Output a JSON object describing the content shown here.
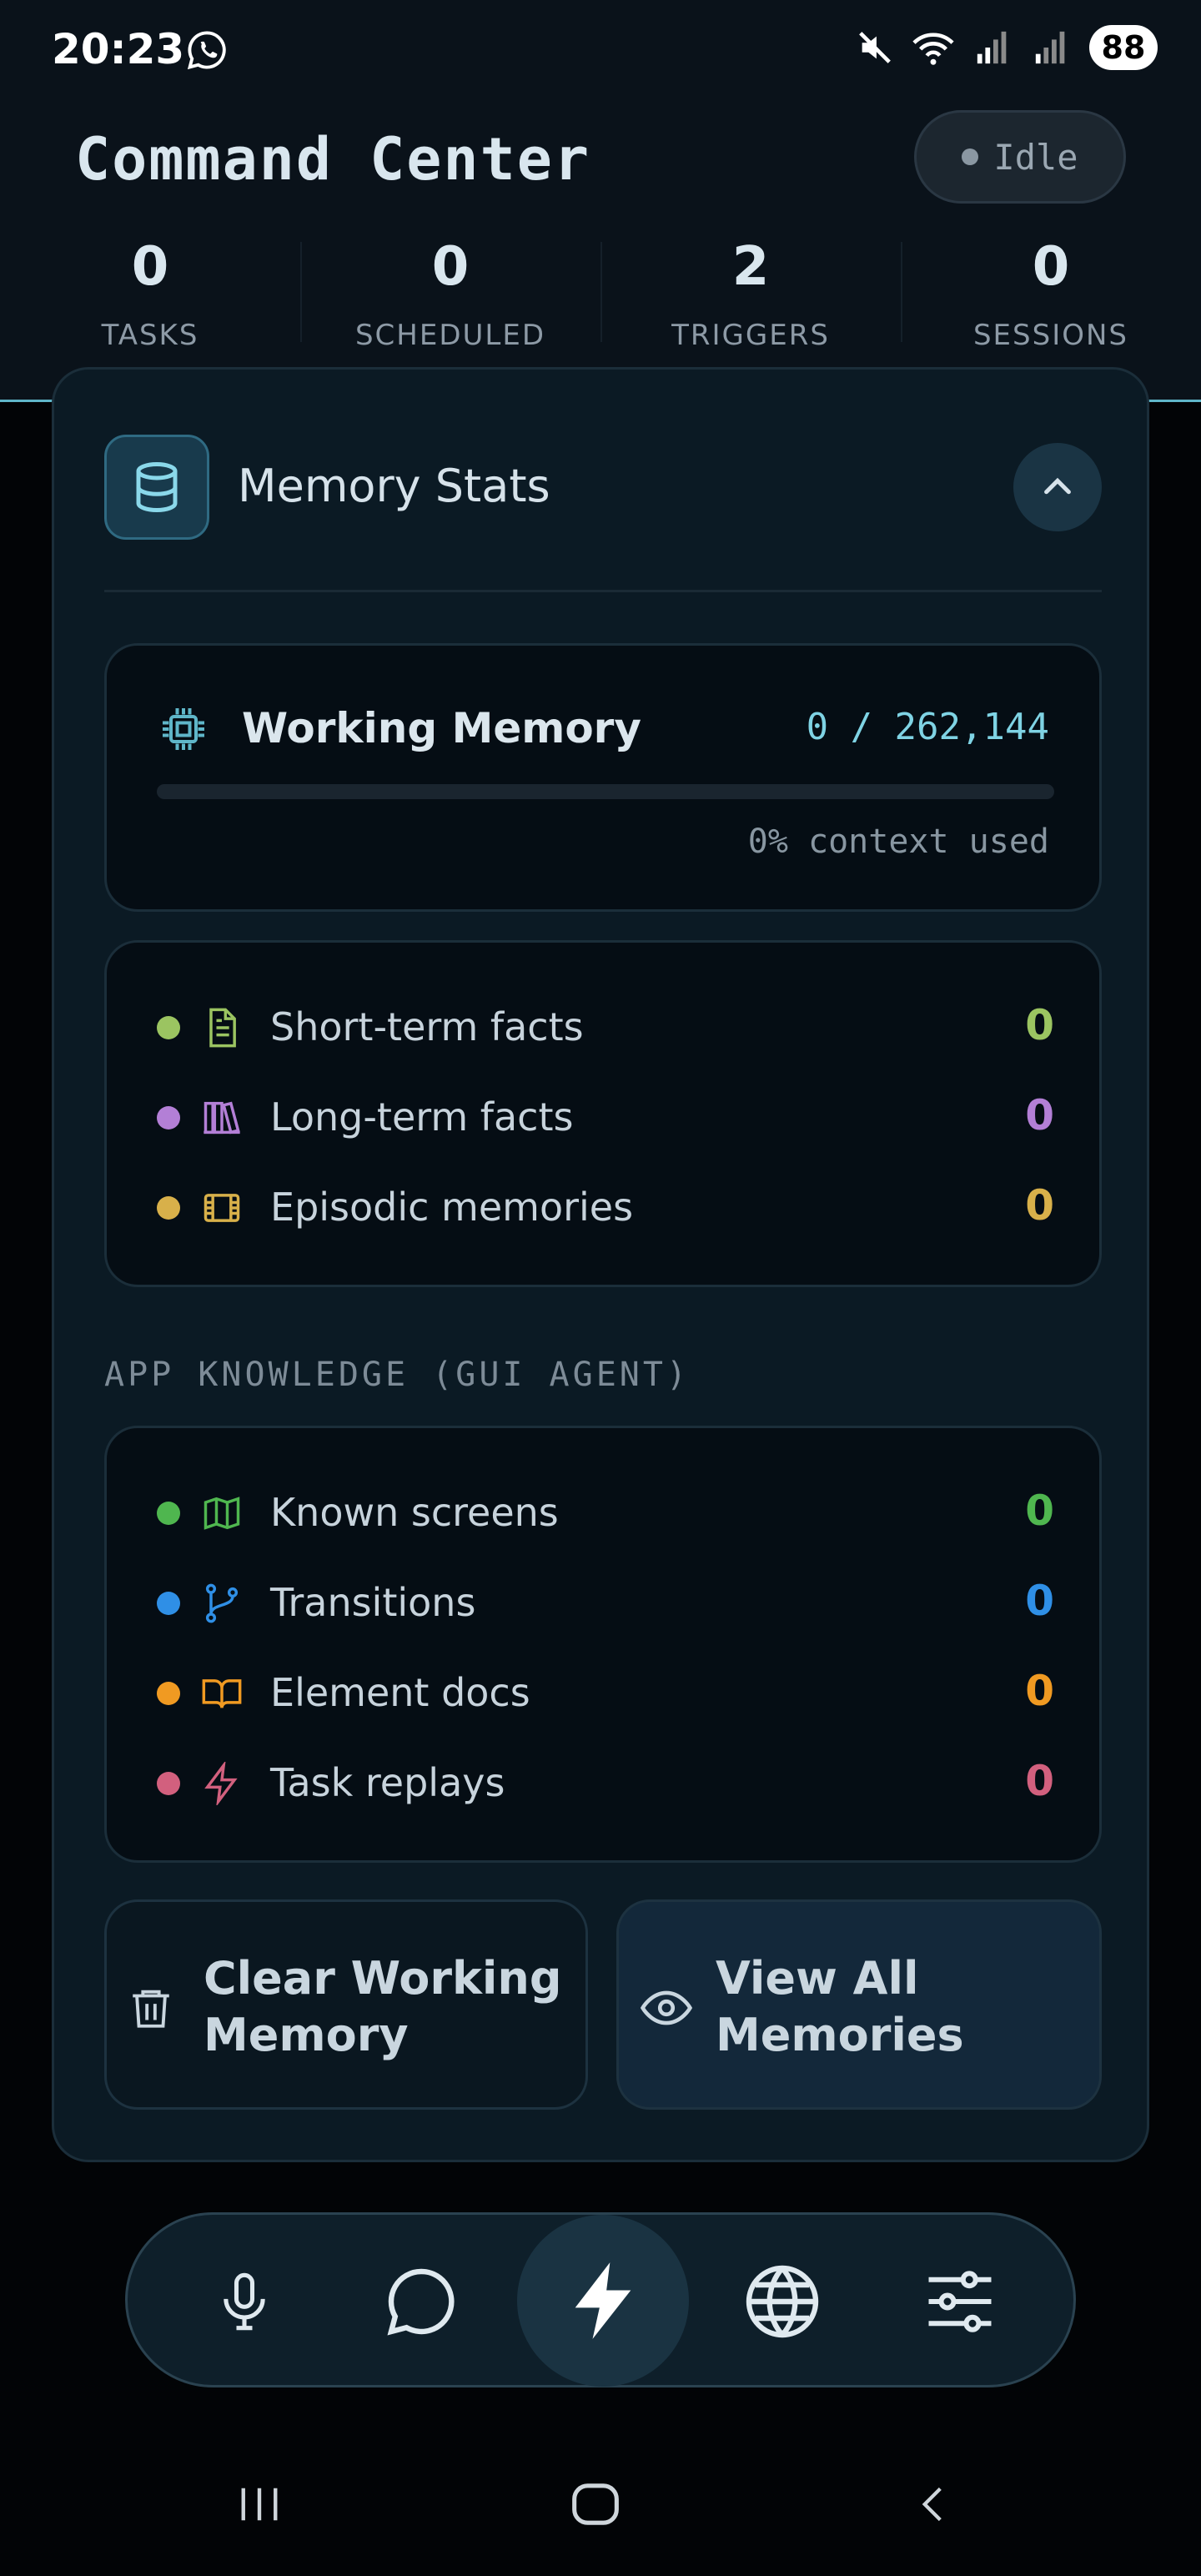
{
  "status_bar": {
    "time": "20:23",
    "battery": "88"
  },
  "header": {
    "title": "Command Center",
    "status": "Idle",
    "stats": [
      {
        "value": "0",
        "label": "TASKS"
      },
      {
        "value": "0",
        "label": "SCHEDULED"
      },
      {
        "value": "2",
        "label": "TRIGGERS"
      },
      {
        "value": "0",
        "label": "SESSIONS"
      }
    ]
  },
  "memory_card": {
    "title": "Memory Stats",
    "working_memory": {
      "title": "Working Memory",
      "count": "0 / 262,144",
      "context_used": "0% context used",
      "progress_fraction": 0
    },
    "facts": [
      {
        "label": "Short-term facts",
        "value": "0",
        "color": "#9bc461",
        "icon": "file-text-icon"
      },
      {
        "label": "Long-term facts",
        "value": "0",
        "color": "#b37fd6",
        "icon": "library-icon"
      },
      {
        "label": "Episodic memories",
        "value": "0",
        "color": "#d8b04a",
        "icon": "film-icon"
      }
    ],
    "app_knowledge": {
      "section_label": "APP KNOWLEDGE (GUI AGENT)",
      "items": [
        {
          "label": "Known screens",
          "value": "0",
          "color": "#4fb64f",
          "icon": "map-icon"
        },
        {
          "label": "Transitions",
          "value": "0",
          "color": "#2f8fe6",
          "icon": "git-branch-icon"
        },
        {
          "label": "Element docs",
          "value": "0",
          "color": "#f09a22",
          "icon": "book-open-icon"
        },
        {
          "label": "Task replays",
          "value": "0",
          "color": "#d2607e",
          "icon": "zap-icon"
        }
      ]
    },
    "actions": {
      "clear_label": "Clear Working Memory",
      "view_label": "View All Memories"
    }
  },
  "bottom_nav": {
    "items": [
      "microphone-icon",
      "chat-icon",
      "lightning-icon",
      "globe-icon",
      "sliders-icon"
    ],
    "active": "lightning-icon"
  }
}
